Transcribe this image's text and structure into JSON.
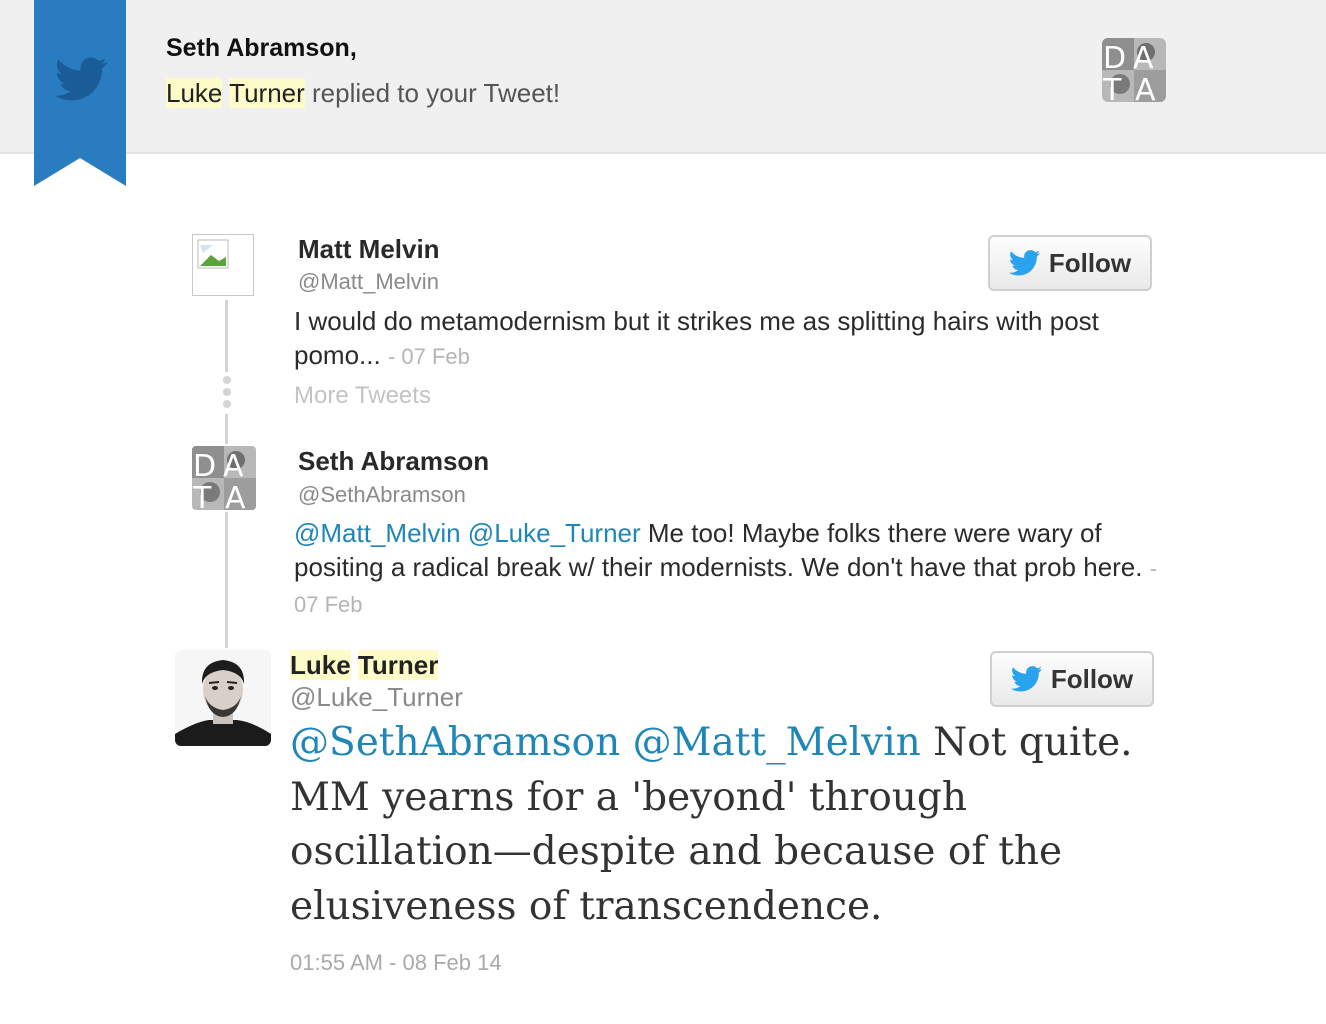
{
  "header": {
    "greeting_name": "Seth Abramson,",
    "reply_first": "Luke",
    "reply_last": "Turner",
    "reply_rest": "replied to your Tweet!",
    "ribbon_color": "#2a7cc1"
  },
  "tweets": [
    {
      "name": "Matt Melvin",
      "handle": "@Matt_Melvin",
      "text": "I would do metamodernism but it strikes me as splitting hairs with post pomo...",
      "date": "- 07 Feb",
      "follow_label": "Follow"
    },
    {
      "name": "Seth Abramson",
      "handle": "@SethAbramson",
      "mention_1": "@Matt_Melvin",
      "mention_2": "@Luke_Turner",
      "text": "Me too! Maybe folks there were wary of positing a radical break w/ their modernists. We don't have that prob here.",
      "date": "- 07 Feb"
    }
  ],
  "more_tweets": "More Tweets",
  "reply": {
    "first": "Luke",
    "last": "Turner",
    "handle": "@Luke_Turner",
    "follow_label": "Follow",
    "mention_1": "@SethAbramson",
    "mention_2": "@Matt_Melvin",
    "text": "Not quite. MM yearns for a 'beyond' through oscillation—despite and because of the elusiveness of transcendence.",
    "timestamp": "01:55 AM - 08 Feb 14"
  },
  "avatar_logo_text": "DATA",
  "accent": "#1f86b8"
}
